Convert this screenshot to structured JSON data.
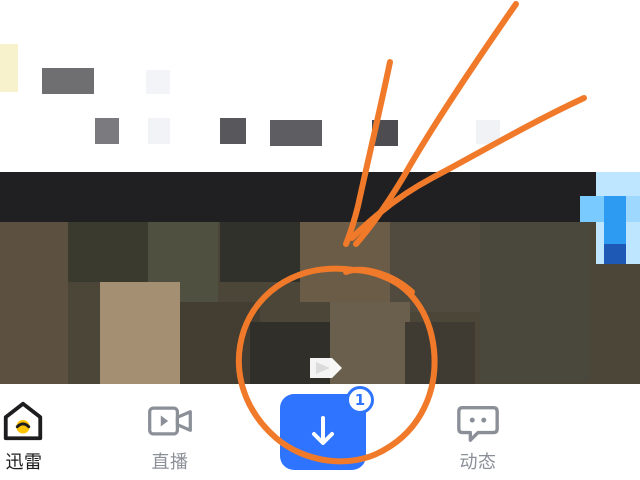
{
  "bottom_nav": {
    "items": [
      {
        "id": "home",
        "label": "迅雷",
        "icon": "home-icon"
      },
      {
        "id": "live",
        "label": "直播",
        "icon": "video-camera-icon"
      },
      {
        "id": "download",
        "label": "",
        "icon": "download-arrow-icon",
        "badge": "1"
      },
      {
        "id": "dynamic",
        "label": "动态",
        "icon": "chat-bubble-icon"
      }
    ]
  },
  "colors": {
    "accent_blue": "#2f74ff",
    "annotation_orange": "#f07a2a",
    "inactive_nav": "#8b8f98"
  }
}
